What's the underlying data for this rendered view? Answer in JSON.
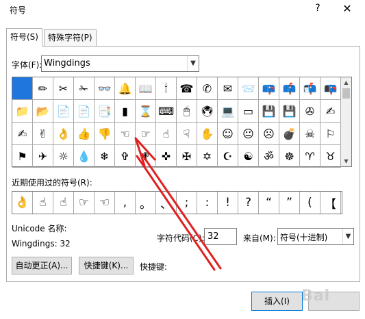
{
  "window": {
    "title": "符号",
    "help": "?",
    "close": "✕"
  },
  "tabs": [
    {
      "label": "符号(S)"
    },
    {
      "label": "特殊字符(P)"
    }
  ],
  "font": {
    "label": "字体(F):",
    "value": "Wingdings"
  },
  "grid": {
    "cells": [
      "",
      "✏",
      "✂",
      "✁",
      "👓",
      "🔔",
      "📖",
      "🕯",
      "☎",
      "✆",
      "✉",
      "📨",
      "📪",
      "📫",
      "📬",
      "📭",
      "📁",
      "📂",
      "📄",
      "📄",
      "📑",
      "▮",
      "⌛",
      "⌨",
      "🖱",
      "🖲",
      "💻",
      "▭",
      "💾",
      "💾",
      "✇",
      "✍",
      "✍",
      "✌",
      "👌",
      "👍",
      "👎",
      "☜",
      "☞",
      "☝",
      "☟",
      "✋",
      "☺",
      "😐",
      "☹",
      "💣",
      "☠",
      "⚐",
      "⚑",
      "✈",
      "☼",
      "💧",
      "❄",
      "✞",
      "✟",
      "✜",
      "✠",
      "✡",
      "☪",
      "☯",
      "ॐ",
      "☸",
      "♈",
      "♉"
    ],
    "selected_index": 0
  },
  "recent": {
    "label": "近期使用过的符号(R):",
    "items": [
      "👌",
      "☝",
      "☝",
      "☞",
      "☜",
      ",",
      "。",
      "、",
      ";",
      ":",
      "!",
      "?",
      "“",
      "”",
      "(",
      "【"
    ]
  },
  "unicode_name_label": "Unicode 名称:",
  "wingdings_code": "Wingdings: 32",
  "char_code": {
    "label": "字符代码(C):",
    "value": "32"
  },
  "from": {
    "label": "来自(M):",
    "value": "符号(十进制)"
  },
  "buttons": {
    "autocorrect": "自动更正(A)...",
    "shortcut": "快捷键(K)...",
    "shortcut_label": "快捷键:",
    "insert": "插入(I)"
  },
  "watermark": "Bai"
}
